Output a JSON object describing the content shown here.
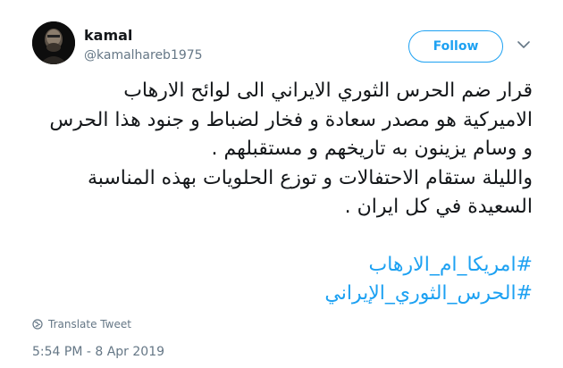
{
  "user": {
    "name": "kamal",
    "handle": "@kamalhareb1975"
  },
  "follow_label": "Follow",
  "tweet": {
    "lines": [
      "قرار ضم الحرس الثوري الايراني الى لوائح الارهاب",
      "الاميركية هو مصدر سعادة و فخار لضباط و جنود هذا الحرس",
      "و وسام يزينون به تاريخهم و مستقبلهم .",
      "والليلة ستقام الاحتفالات و توزع الحلويات بهذه المناسبة",
      "السعيدة في كل ايران ."
    ],
    "hashtags": [
      "#امريكا_ام_الارهاب",
      "#الحرس_الثوري_الإيراني"
    ]
  },
  "translate_label": "Translate Tweet",
  "timestamp": "5:54 PM - 8 Apr 2019",
  "colors": {
    "accent": "#1da1f2",
    "muted": "#657786",
    "text": "#14171a"
  },
  "icons": {
    "caret": "chevron-down-icon",
    "translate": "globe-icon"
  }
}
